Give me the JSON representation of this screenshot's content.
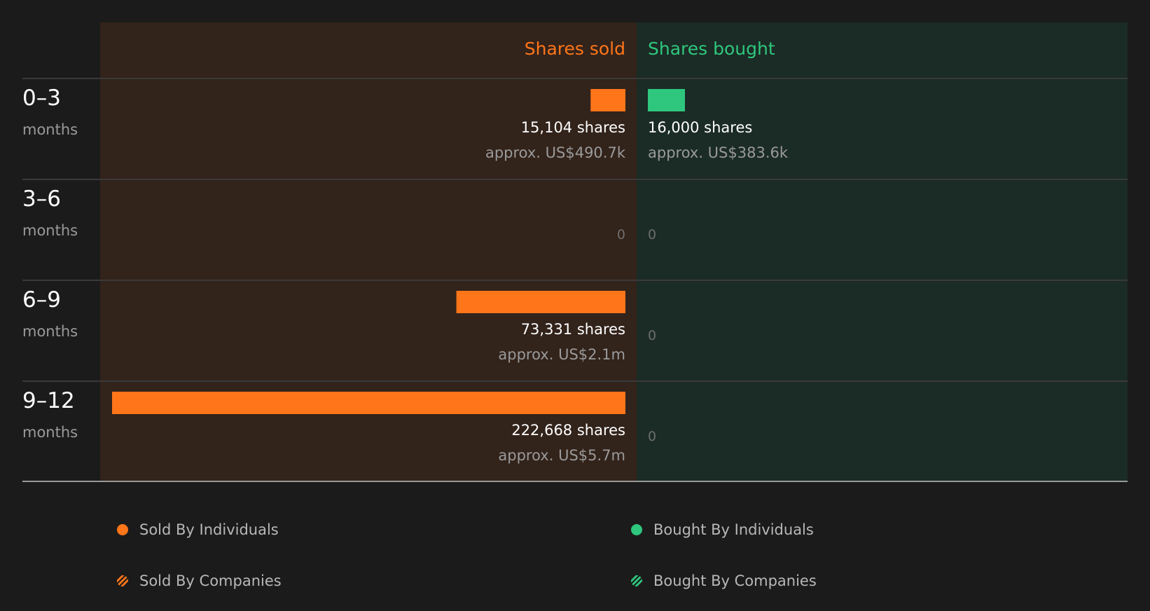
{
  "chart_data": {
    "type": "bar",
    "orientation": "horizontal-diverging",
    "column_headers": {
      "sold": "Shares sold",
      "bought": "Shares bought"
    },
    "rows": [
      {
        "range": "0–3",
        "unit": "months",
        "sold_shares": 15104,
        "sold_label": "15,104 shares",
        "sold_value": "approx. US$490.7k",
        "bought_shares": 16000,
        "bought_label": "16,000 shares",
        "bought_value": "approx. US$383.6k"
      },
      {
        "range": "3–6",
        "unit": "months",
        "sold_shares": 0,
        "sold_label": "0",
        "sold_value": "",
        "bought_shares": 0,
        "bought_label": "0",
        "bought_value": ""
      },
      {
        "range": "6–9",
        "unit": "months",
        "sold_shares": 73331,
        "sold_label": "73,331 shares",
        "sold_value": "approx. US$2.1m",
        "bought_shares": 0,
        "bought_label": "0",
        "bought_value": ""
      },
      {
        "range": "9–12",
        "unit": "months",
        "sold_shares": 222668,
        "sold_label": "222,668 shares",
        "sold_value": "approx. US$5.7m",
        "bought_shares": 0,
        "bought_label": "0",
        "bought_value": ""
      }
    ],
    "max_shares": 222668,
    "colors": {
      "sold": "#ff7519",
      "bought": "#2ec77d",
      "sold_bg": "#32231b",
      "bought_bg": "#1b2b25"
    }
  },
  "legend": [
    {
      "label": "Sold By Individuals",
      "color": "#ff7519",
      "pattern": "solid"
    },
    {
      "label": "Bought By Individuals",
      "color": "#2ec77d",
      "pattern": "solid"
    },
    {
      "label": "Sold By Companies",
      "color": "#ff7519",
      "pattern": "striped"
    },
    {
      "label": "Bought By Companies",
      "color": "#2ec77d",
      "pattern": "striped"
    }
  ]
}
